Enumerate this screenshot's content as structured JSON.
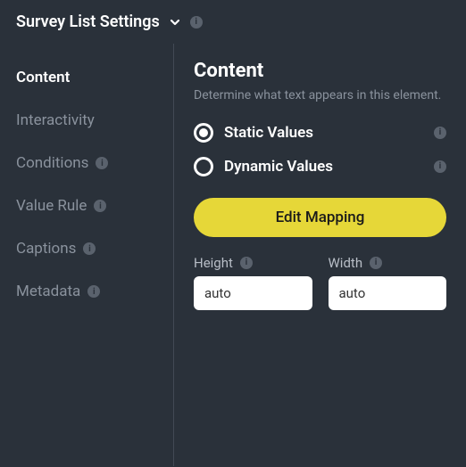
{
  "header": {
    "title": "Survey List Settings"
  },
  "sidebar": {
    "items": [
      {
        "label": "Content",
        "has_info": false,
        "active": true
      },
      {
        "label": "Interactivity",
        "has_info": false,
        "active": false
      },
      {
        "label": "Conditions",
        "has_info": true,
        "active": false
      },
      {
        "label": "Value Rule",
        "has_info": true,
        "active": false
      },
      {
        "label": "Captions",
        "has_info": true,
        "active": false
      },
      {
        "label": "Metadata",
        "has_info": true,
        "active": false
      }
    ]
  },
  "main": {
    "title": "Content",
    "description": "Determine what text appears in this element.",
    "options": {
      "static_label": "Static Values",
      "dynamic_label": "Dynamic Values",
      "selected": "static"
    },
    "edit_button": "Edit Mapping",
    "fields": {
      "height_label": "Height",
      "height_value": "auto",
      "width_label": "Width",
      "width_value": "auto"
    }
  },
  "colors": {
    "accent": "#e6d738",
    "bg": "#2a313a"
  }
}
